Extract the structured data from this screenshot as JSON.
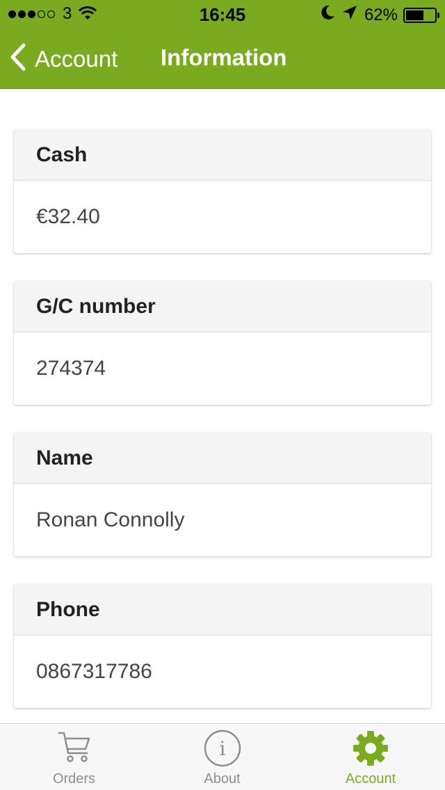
{
  "status_bar": {
    "carrier": "3",
    "time": "16:45",
    "battery_text": "62%",
    "battery_level": 0.62,
    "signal_bars_filled": 3,
    "signal_bars_total": 5
  },
  "navbar": {
    "back_label": "Account",
    "title": "Information"
  },
  "cards": [
    {
      "header": "Cash",
      "value": "€32.40"
    },
    {
      "header": "G/C number",
      "value": "274374"
    },
    {
      "header": "Name",
      "value": "Ronan Connolly"
    },
    {
      "header": "Phone",
      "value": "0867317786"
    }
  ],
  "tabbar": {
    "tabs": [
      {
        "label": "Orders",
        "icon": "cart-icon"
      },
      {
        "label": "About",
        "icon": "info-icon"
      },
      {
        "label": "Account",
        "icon": "gear-icon"
      }
    ],
    "active": "Account"
  },
  "colors": {
    "brand": "#7aaa1f",
    "tab_inactive": "#8e8e8e"
  }
}
